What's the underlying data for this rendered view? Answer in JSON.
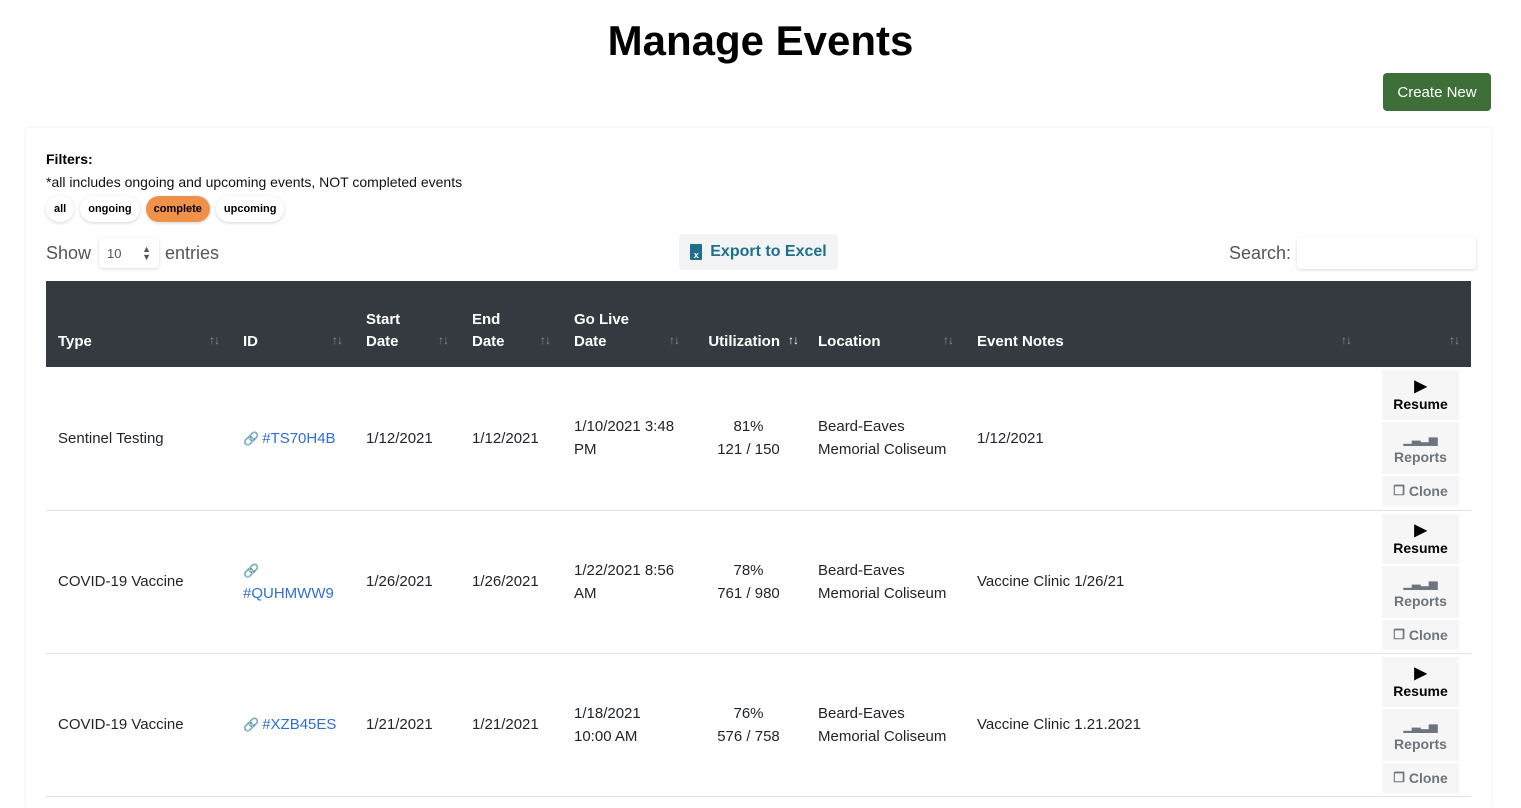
{
  "page": {
    "title": "Manage Events"
  },
  "toolbar": {
    "create_label": "Create New"
  },
  "filters": {
    "label": "Filters:",
    "note": "*all includes ongoing and upcoming events, NOT completed events",
    "pills": [
      "all",
      "ongoing",
      "complete",
      "upcoming"
    ],
    "active": "complete"
  },
  "length": {
    "show_label": "Show",
    "value": "10",
    "entries_label": "entries"
  },
  "export": {
    "label": "Export to Excel"
  },
  "search": {
    "label": "Search:",
    "value": ""
  },
  "table": {
    "headers": [
      "Type",
      "ID",
      "Start Date",
      "End Date",
      "Go Live Date",
      "Utilization",
      "Location",
      "Event Notes",
      ""
    ],
    "sorted_column": "Utilization",
    "rows": [
      {
        "type": "Sentinel Testing",
        "id": "#TS70H4B",
        "start": "1/12/2021",
        "end": "1/12/2021",
        "golive": "1/10/2021 3:48 PM",
        "util_pct": "81%",
        "util_count": "121 / 150",
        "location": "Beard-Eaves Memorial Coliseum",
        "notes": "1/12/2021"
      },
      {
        "type": "COVID-19 Vaccine",
        "id": "#QUHMWW9",
        "start": "1/26/2021",
        "end": "1/26/2021",
        "golive": "1/22/2021 8:56 AM",
        "util_pct": "78%",
        "util_count": "761 / 980",
        "location": "Beard-Eaves Memorial Coliseum",
        "notes": "Vaccine Clinic 1/26/21"
      },
      {
        "type": "COVID-19 Vaccine",
        "id": "#XZB45ES",
        "start": "1/21/2021",
        "end": "1/21/2021",
        "golive": "1/18/2021 10:00 AM",
        "util_pct": "76%",
        "util_count": "576 / 758",
        "location": "Beard-Eaves Memorial Coliseum",
        "notes": "Vaccine Clinic 1.21.2021"
      }
    ],
    "actions": {
      "resume": "Resume",
      "reports": "Reports",
      "clone": "Clone"
    }
  },
  "colors": {
    "header_bg": "#343a40",
    "create_bg": "#3e6f39",
    "active_pill": "#f0914a",
    "link": "#2f6fd0",
    "export_text": "#1f6f8b"
  }
}
